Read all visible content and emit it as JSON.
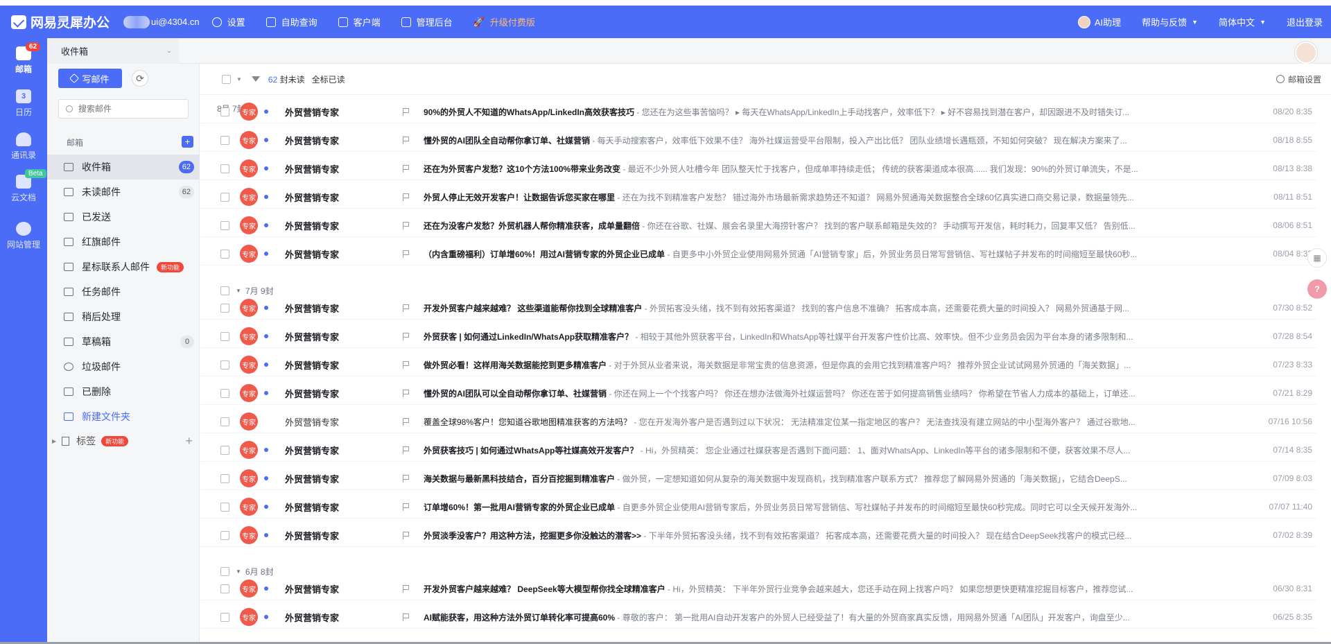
{
  "app": {
    "name": "网易灵犀办公",
    "account": "ui@4304.cn"
  },
  "topnav": {
    "items": [
      "设置",
      "自助查询",
      "客户端",
      "管理后台",
      "升级付费版"
    ],
    "ai_label": "AI助理",
    "help_label": "帮助与反馈",
    "lang_label": "简体中文",
    "logout_label": "退出登录"
  },
  "leftbar": {
    "items": [
      {
        "label": "邮箱",
        "badge": "62"
      },
      {
        "label": "日历",
        "day": "3"
      },
      {
        "label": "通讯录"
      },
      {
        "label": "云文档",
        "badge": "Beta"
      },
      {
        "label": "网站管理"
      }
    ]
  },
  "tab": {
    "label": "收件箱"
  },
  "sidebar": {
    "compose_label": "写邮件",
    "search_placeholder": "搜索邮件",
    "mailbox_label": "邮箱",
    "folders": [
      {
        "label": "收件箱",
        "count": "62"
      },
      {
        "label": "未读邮件",
        "count": "62"
      },
      {
        "label": "已发送"
      },
      {
        "label": "红旗邮件"
      },
      {
        "label": "星标联系人邮件",
        "tag": "新功能"
      },
      {
        "label": "任务邮件"
      },
      {
        "label": "稍后处理"
      },
      {
        "label": "草稿箱",
        "count": "0"
      },
      {
        "label": "垃圾邮件"
      },
      {
        "label": "已删除"
      },
      {
        "label": "新建文件夹"
      }
    ],
    "tags_label": "标签",
    "tags_tag": "新功能"
  },
  "toolbar": {
    "unread_count": "62",
    "unread_suffix": "封未读",
    "mark_all": "全标已读",
    "settings_label": "邮箱设置"
  },
  "groups": [
    {
      "label": "8月 7封"
    },
    {
      "label": "7月 9封"
    },
    {
      "label": "6月 8封"
    }
  ],
  "avatar_text": "专家",
  "emails": [
    {
      "sender": "外贸营销专家",
      "subject": "90%的外贸人不知道的WhatsApp/LinkedIn高效获客技巧",
      "preview": " - 您还在为这些事苦恼吗？ ▸ 每天在WhatsApp/LinkedIn上手动找客户，效率低下？ ▸ 好不容易找到潜在客户，却因跟进不及时错失订...",
      "date": "08/20 8:35",
      "unread": true
    },
    {
      "sender": "外贸营销专家",
      "subject": "懂外贸的AI团队全自动帮你拿订单、社媒营销",
      "preview": " - 每天手动搜索客户，效率低下效果不佳？ 海外社媒运营受平台限制，投入产出比低？ 团队业绩增长遇瓶颈，不知如何突破？ 现在解决方案来了...",
      "date": "08/18 8:55",
      "unread": true
    },
    {
      "sender": "外贸营销专家",
      "subject": "还在为外贸客户发愁？这10个方法100%带来业务改变",
      "preview": " - 最近不少外贸人吐槽今年 团队整天忙于找客户，但成单率持续走低； 传统的获客渠道成本很高...... 我们发现：90%的外贸订单流失，不是...",
      "date": "08/13 8:38",
      "unread": true
    },
    {
      "sender": "外贸营销专家",
      "subject": "外贸人停止无效开发客户！让数据告诉您买家在哪里",
      "preview": " - 还在为找不到精准客户发愁？ 错过海外市场最新需求趋势还不知道？ 网易外贸通海关数据整合全球60亿真实进口商交易记录，数据量领先...",
      "date": "08/11 8:51",
      "unread": true
    },
    {
      "sender": "外贸营销专家",
      "subject": "还在为没客户发愁？外贸机器人帮你精准获客，成单量翻倍",
      "preview": " - 你还在谷歌、社媒、展会名录里大海捞针客户？ 找到的客户联系邮箱是失效的？ 手动撰写开发信，耗时耗力，回复率又低？ 告别低...",
      "date": "08/06 8:51",
      "unread": true
    },
    {
      "sender": "外贸营销专家",
      "subject": "（内含重磅福利）订单增60%！用过AI营销专家的外贸企业已成单",
      "preview": " - 自更多中小外贸企业使用网易外贸通「AI营销专家」后，外贸业务员日常写营销信、写社媒帖子并发布的时间缩短至最快60秒...",
      "date": "08/04 8:33",
      "unread": true
    },
    {
      "sender": "外贸营销专家",
      "subject": "开发外贸客户越来越难？ 这些渠道能帮你找到全球精准客户",
      "preview": " - 外贸拓客没头绪，找不到有效拓客渠道？ 找到的客户信息不准确？ 拓客成本高，还需要花费大量的时间投入？ 网易外贸通基于网...",
      "date": "07/30 8:52",
      "unread": true
    },
    {
      "sender": "外贸营销专家",
      "subject": "外贸获客 | 如何通过LinkedIn/WhatsApp获取精准客户？",
      "preview": " - 相较于其他外贸获客平台，LinkedIn和WhatsApp等社媒平台开发客户性价比高、效率快。但不少业务员会因为平台本身的诸多限制和...",
      "date": "07/28 8:54",
      "unread": true
    },
    {
      "sender": "外贸营销专家",
      "subject": "做外贸必看！这样用海关数据能挖到更多精准客户",
      "preview": " - 对于外贸从业者来说，海关数据是非常宝贵的信息资源，但是你真的会用它找到精准客户吗？ 推荐外贸企业试试网易外贸通的「海关数据」...",
      "date": "07/23 8:33",
      "unread": true
    },
    {
      "sender": "外贸营销专家",
      "subject": "懂外贸的AI团队可以全自动帮你拿订单、社媒营销",
      "preview": " - 你还在网上一个个找客户吗？ 你还在想办法做海外社媒运营吗？ 你还在苦于如何提高销售业绩吗？ 你希望在节省人力成本的基础上，订单还...",
      "date": "07/21 8:29",
      "unread": true
    },
    {
      "sender": "外贸营销专家",
      "subject": "覆盖全球98%客户！您知道谷歌地图精准获客的方法吗？",
      "preview": " - 您在开发海外客户是否遇到过以下状况： 无法精准定位某一指定地区的客户？ 无法查找没有建立网站的中小型海外客户？ 通过谷歌地...",
      "date": "07/16 10:56",
      "unread": false
    },
    {
      "sender": "外贸营销专家",
      "subject": "外贸获客技巧 | 如何通过WhatsApp等社媒高效开发客户？",
      "preview": " - Hi，外贸精英： 您企业通过社媒获客是否遇到下面问题： 1、面对WhatsApp、LinkedIn等平台的诸多限制和不便，获客效果不尽人...",
      "date": "07/14 8:35",
      "unread": true
    },
    {
      "sender": "外贸营销专家",
      "subject": "海关数据与最新黑科技结合，百分百挖掘到精准客户",
      "preview": " - 做外贸，一定想知道如何从复杂的海关数据中发现商机，找到精准客户联系方式？ 推荐您了解网易外贸通的「海关数据」，它结合DeepS...",
      "date": "07/09 8:03",
      "unread": true
    },
    {
      "sender": "外贸营销专家",
      "subject": "订单增60%！第一批用AI营销专家的外贸企业已成单",
      "preview": " - 自更多外贸企业使用AI营销专家后，外贸业务员日常写营销信、写社媒帖子并发布的时间缩短至最快60秒完成。同时它可以全天候开发海外...",
      "date": "07/07 11:40",
      "unread": true
    },
    {
      "sender": "外贸营销专家",
      "subject": "外贸淡季没客户？用这种方法，挖掘更多你没触达的潜客>>",
      "preview": " - 下半年外贸拓客没头绪，找不到有效拓客渠道？ 拓客成本高，还需要花费大量的时间投入？ 现在结合DeepSeek找客户的模式已经...",
      "date": "07/02 8:39",
      "unread": true
    },
    {
      "sender": "外贸营销专家",
      "subject": "开发外贸客户越来越难？ DeepSeek等大模型帮你找全球精准客户",
      "preview": " - Hi，外贸精英： 下半年外贸行业竞争会越来越大，您还手动在网上找客户吗？ 如果您想更快更精准挖掘目标客户，推荐您试...",
      "date": "06/30 8:31",
      "unread": true
    },
    {
      "sender": "外贸营销专家",
      "subject": "AI赋能获客，用这种方法外贸订单转化率可提高60%",
      "preview": " - 尊敬的客户： 第一批用AI自动开发客户的外贸人已经受益了！有大量的外贸商家真实反馈，用网易外贸通「AI团队」开发客户，询盘至少...",
      "date": "06/25 8:35",
      "unread": true
    }
  ]
}
